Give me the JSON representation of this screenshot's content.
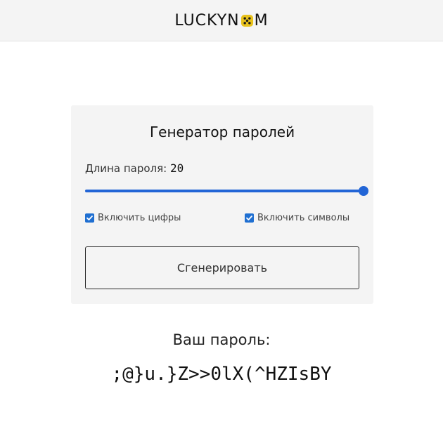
{
  "header": {
    "logo_left": "LUCKYN",
    "logo_right": "M",
    "logo_icon": "dice-icon",
    "background": "#f4f4f4"
  },
  "card": {
    "title": "Генератор паролей",
    "length_label": "Длина пароля:",
    "length_value": "20",
    "slider": {
      "value": 20,
      "min": 4,
      "max": 20,
      "color": "#2265d6"
    },
    "include_digits": {
      "label": "Включить цифры",
      "checked": true
    },
    "include_symbols": {
      "label": "Включить символы",
      "checked": true
    },
    "generate_button": "Сгенерировать"
  },
  "result": {
    "label": "Ваш пароль:",
    "password": ";@}u.}Z>>0lX(^HZIsBY"
  },
  "colors": {
    "accent": "#2265d6",
    "checkbox": "#1f6fd1",
    "logo_die": "#e8c21c"
  }
}
